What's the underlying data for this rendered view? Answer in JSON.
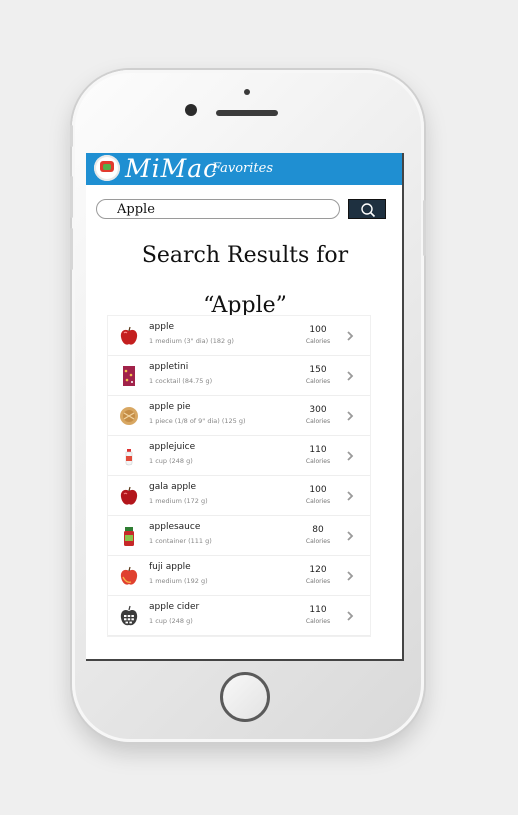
{
  "app": {
    "brand": "MiMac",
    "favorites_label": "Favorites"
  },
  "search": {
    "value": "Apple"
  },
  "results": {
    "title_line1": "Search Results for",
    "title_line2": "“Apple”"
  },
  "calories_label": "Calories",
  "foods": [
    {
      "name": "apple",
      "serving": "1 medium (3\" dia) (182 g)",
      "calories": "100",
      "icon": "red-apple-icon"
    },
    {
      "name": "appletini",
      "serving": "1 cocktail (84.75 g)",
      "calories": "150",
      "icon": "cocktail-icon"
    },
    {
      "name": "apple pie",
      "serving": "1 piece (1/8 of 9\" dia) (125 g)",
      "calories": "300",
      "icon": "pie-icon"
    },
    {
      "name": "applejuice",
      "serving": "1 cup (248 g)",
      "calories": "110",
      "icon": "juice-bottle-icon"
    },
    {
      "name": "gala apple",
      "serving": "1 medium (172 g)",
      "calories": "100",
      "icon": "red-apple-icon"
    },
    {
      "name": "applesauce",
      "serving": "1 container (111 g)",
      "calories": "80",
      "icon": "sauce-jar-icon"
    },
    {
      "name": "fuji apple",
      "serving": "1 medium (192 g)",
      "calories": "120",
      "icon": "red-apple-icon"
    },
    {
      "name": "apple cider",
      "serving": "1 cup (248 g)",
      "calories": "110",
      "icon": "food-placeholder-icon"
    }
  ],
  "colors": {
    "app_bar": "#1f8fd2",
    "search_button": "#1e3040"
  }
}
